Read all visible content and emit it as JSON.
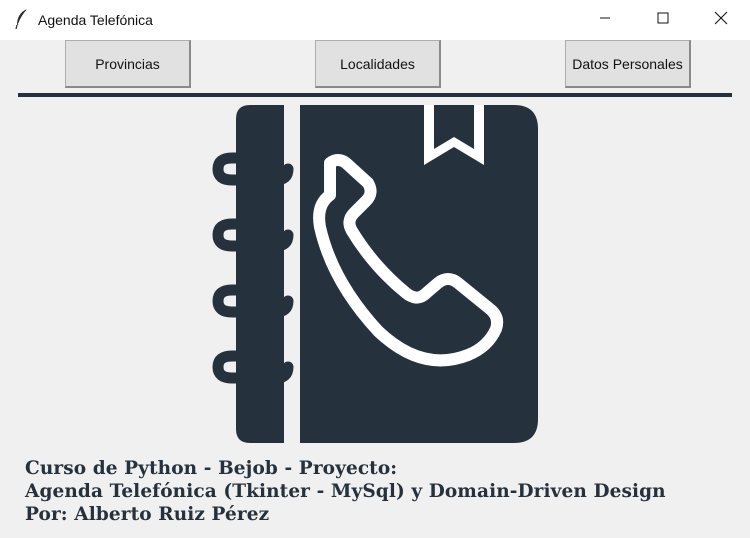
{
  "window": {
    "title": "Agenda Telefónica",
    "icon": "feather-icon",
    "controls": [
      "minimize-icon",
      "maximize-icon",
      "close-icon"
    ]
  },
  "toolbar": {
    "provincias_label": "Provincias",
    "localidades_label": "Localidades",
    "datos_label": "Datos Personales"
  },
  "logo": {
    "icon": "phone-book-icon",
    "color": "#25313d"
  },
  "caption": {
    "line1": "Curso de Python - Bejob - Proyecto:",
    "line2": "Agenda Telefónica (Tkinter - MySql) y Domain-Driven Design",
    "line3": "Por: Alberto Ruiz Pérez"
  },
  "colors": {
    "accent": "#25313d",
    "background": "#f0f0f0",
    "button": "#e1e1e1"
  }
}
